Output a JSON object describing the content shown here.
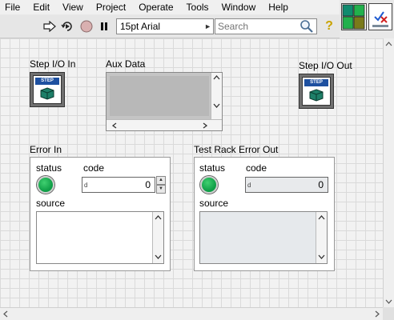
{
  "menu": [
    "File",
    "Edit",
    "View",
    "Project",
    "Operate",
    "Tools",
    "Window",
    "Help"
  ],
  "toolbar": {
    "font_select": "15pt Arial",
    "search_placeholder": "Search",
    "help_label": "?"
  },
  "terminals": {
    "step_in_label": "Step I/O In",
    "step_out_label": "Step I/O Out",
    "step_tag": "STEP"
  },
  "aux": {
    "label": "Aux Data"
  },
  "error_in": {
    "label": "Error In",
    "status_label": "status",
    "code_label": "code",
    "code_radix": "d",
    "code_value": "0",
    "source_label": "source"
  },
  "error_out": {
    "label": "Test Rack Error Out",
    "status_label": "status",
    "code_label": "code",
    "code_radix": "d",
    "code_value": "0",
    "source_label": "source"
  },
  "colors": {
    "led_on": "#1aa34a",
    "step_blue": "#1e50a0",
    "cube_teal": "#1d7f68"
  }
}
